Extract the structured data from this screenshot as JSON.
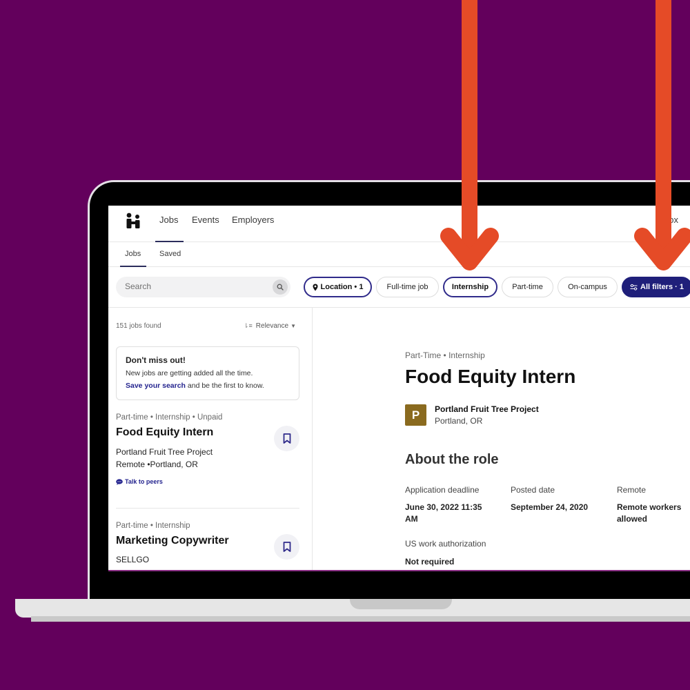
{
  "colors": {
    "background": "#63005c",
    "arrow": "#e54b27",
    "brand_navy": "#1f1f7a",
    "link": "#23238e",
    "employer_logo_bg": "#8a6a1f"
  },
  "topnav": {
    "logo": "handshake-logo",
    "items": [
      {
        "label": "Jobs",
        "active": true
      },
      {
        "label": "Events"
      },
      {
        "label": "Employers"
      }
    ],
    "right_text": "box"
  },
  "subnav": {
    "items": [
      {
        "label": "Jobs",
        "active": true
      },
      {
        "label": "Saved"
      }
    ]
  },
  "filterbar": {
    "search_placeholder": "Search",
    "chips": [
      {
        "label": "Location • 1",
        "icon": "map-pin-icon",
        "state": "active"
      },
      {
        "label": "Full-time job",
        "state": "default"
      },
      {
        "label": "Internship",
        "state": "active"
      },
      {
        "label": "Part-time",
        "state": "default"
      },
      {
        "label": "On-campus",
        "state": "default"
      },
      {
        "label": "All filters · 1",
        "icon": "sliders-icon",
        "state": "primary"
      }
    ]
  },
  "results": {
    "count_label": "151 jobs found",
    "sort_label": "Relevance"
  },
  "promo": {
    "title": "Don't miss out!",
    "text": "New jobs are getting added all the time.",
    "link_label": "Save your search",
    "link_suffix": " and be the first to know."
  },
  "jobs": [
    {
      "meta": "Part-time • Internship • Unpaid",
      "title": "Food Equity Intern",
      "company": "Portland Fruit Tree Project",
      "location": "Remote •Portland, OR",
      "peers_label": "Talk to peers"
    },
    {
      "meta": "Part-time • Internship",
      "title": "Marketing Copywriter",
      "company": "SELLGO"
    }
  ],
  "detail": {
    "meta": "Part-Time • Internship",
    "title": "Food Equity Intern",
    "employer": {
      "initial": "P",
      "name": "Portland Fruit Tree Project",
      "location": "Portland, OR"
    },
    "about_title": "About the role",
    "fields": [
      {
        "label": "Application deadline",
        "value": "June 30, 2022 11:35 AM"
      },
      {
        "label": "Posted date",
        "value": "September 24, 2020"
      },
      {
        "label": "Remote",
        "value": "Remote workers allowed"
      },
      {
        "label": "US work authorization",
        "value": "Not required"
      }
    ]
  },
  "annotations": {
    "arrows": [
      {
        "points_to": "Internship"
      },
      {
        "points_to": "All filters · 1"
      }
    ]
  }
}
